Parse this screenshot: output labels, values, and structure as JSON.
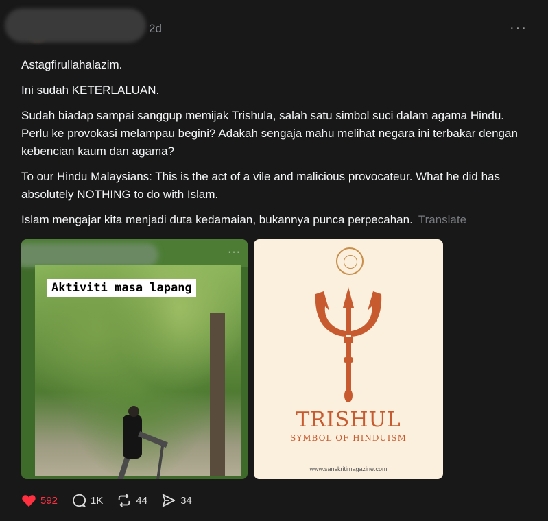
{
  "post": {
    "time": "2d",
    "more": "···",
    "paragraphs": [
      "Astagfirullahalazim.",
      "Ini sudah KETERLALUAN.",
      "Sudah biadap sampai sanggup memijak Trishula, salah satu simbol suci dalam agama Hindu. Perlu ke provokasi melampau begini? Adakah sengaja mahu melihat negara ini terbakar dengan kebencian kaum dan agama?",
      "To our Hindu Malaysians: This is the act of a vile and malicious provocateur. What he did has absolutely NOTHING to do with Islam.",
      "Islam mengajar kita menjadi duta kedamaian, bukannya punca perpecahan."
    ],
    "translate_label": "Translate"
  },
  "media": {
    "left": {
      "caption": "Aktiviti masa lapang",
      "more": "···"
    },
    "right": {
      "title": "TRISHUL",
      "subtitle": "SYMBOL OF HINDUISM",
      "url": "www.sanskritimagazine.com",
      "accent": "#c75a2e"
    }
  },
  "actions": {
    "likes": "592",
    "comments": "1K",
    "reposts": "44",
    "shares": "34",
    "like_color": "#ff3040"
  }
}
